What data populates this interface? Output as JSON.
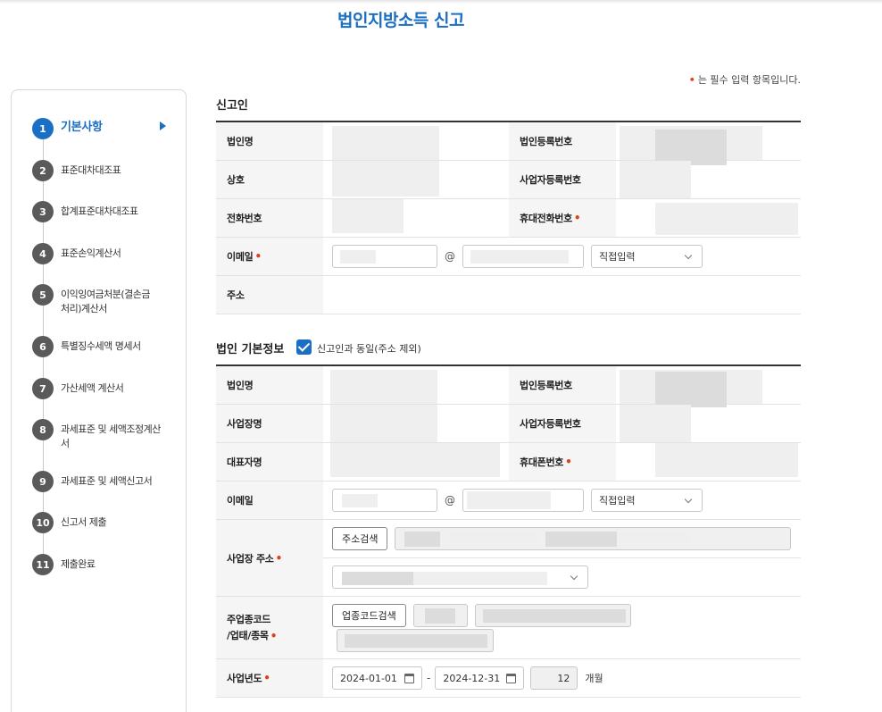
{
  "page": {
    "title": "법인지방소득 신고",
    "required_note": "는 필수 입력 항목입니다."
  },
  "sidebar": {
    "steps": [
      {
        "num": "1",
        "label": "기본사항"
      },
      {
        "num": "2",
        "label": "표준대차대조표"
      },
      {
        "num": "3",
        "label": "합계표준대차대조표"
      },
      {
        "num": "4",
        "label": "표준손익계산서"
      },
      {
        "num": "5",
        "label": "이익잉여금처분(결손금처리)계산서"
      },
      {
        "num": "6",
        "label": "특별징수세액 명세서"
      },
      {
        "num": "7",
        "label": "가산세액 계산서"
      },
      {
        "num": "8",
        "label": "과세표준 및 세액조정계산서"
      },
      {
        "num": "9",
        "label": "과세표준 및 세액신고서"
      },
      {
        "num": "10",
        "label": "신고서 제출"
      },
      {
        "num": "11",
        "label": "제출완료"
      }
    ]
  },
  "declarant": {
    "title": "신고인",
    "labels": {
      "corp_name": "법인명",
      "corp_reg_no": "법인등록번호",
      "trade_name": "상호",
      "biz_reg_no": "사업자등록번호",
      "phone": "전화번호",
      "mobile": "휴대전화번호",
      "email": "이메일",
      "address": "주소"
    },
    "email_at": "@",
    "email_domain_select": "직접입력"
  },
  "corp_info": {
    "title": "법인 기본정보",
    "same_as_checkbox": "신고인과 동일(주소 제외)",
    "labels": {
      "corp_name": "법인명",
      "corp_reg_no": "법인등록번호",
      "site_name": "사업장명",
      "biz_reg_no": "사업자등록번호",
      "rep_name": "대표자명",
      "mobile": "휴대폰번호",
      "email": "이메일",
      "site_address": "사업장 주소",
      "industry_code_1": "주업종코드",
      "industry_code_2": "/업태/종목",
      "fiscal_year": "사업년도"
    },
    "email_at": "@",
    "email_domain_select": "직접입력",
    "address_search_button": "주소검색",
    "industry_search_button": "업종코드검색",
    "fiscal_start": "2024-01-01",
    "fiscal_dash": "-",
    "fiscal_end": "2024-12-31",
    "months_value": "12",
    "months_unit": "개월"
  }
}
